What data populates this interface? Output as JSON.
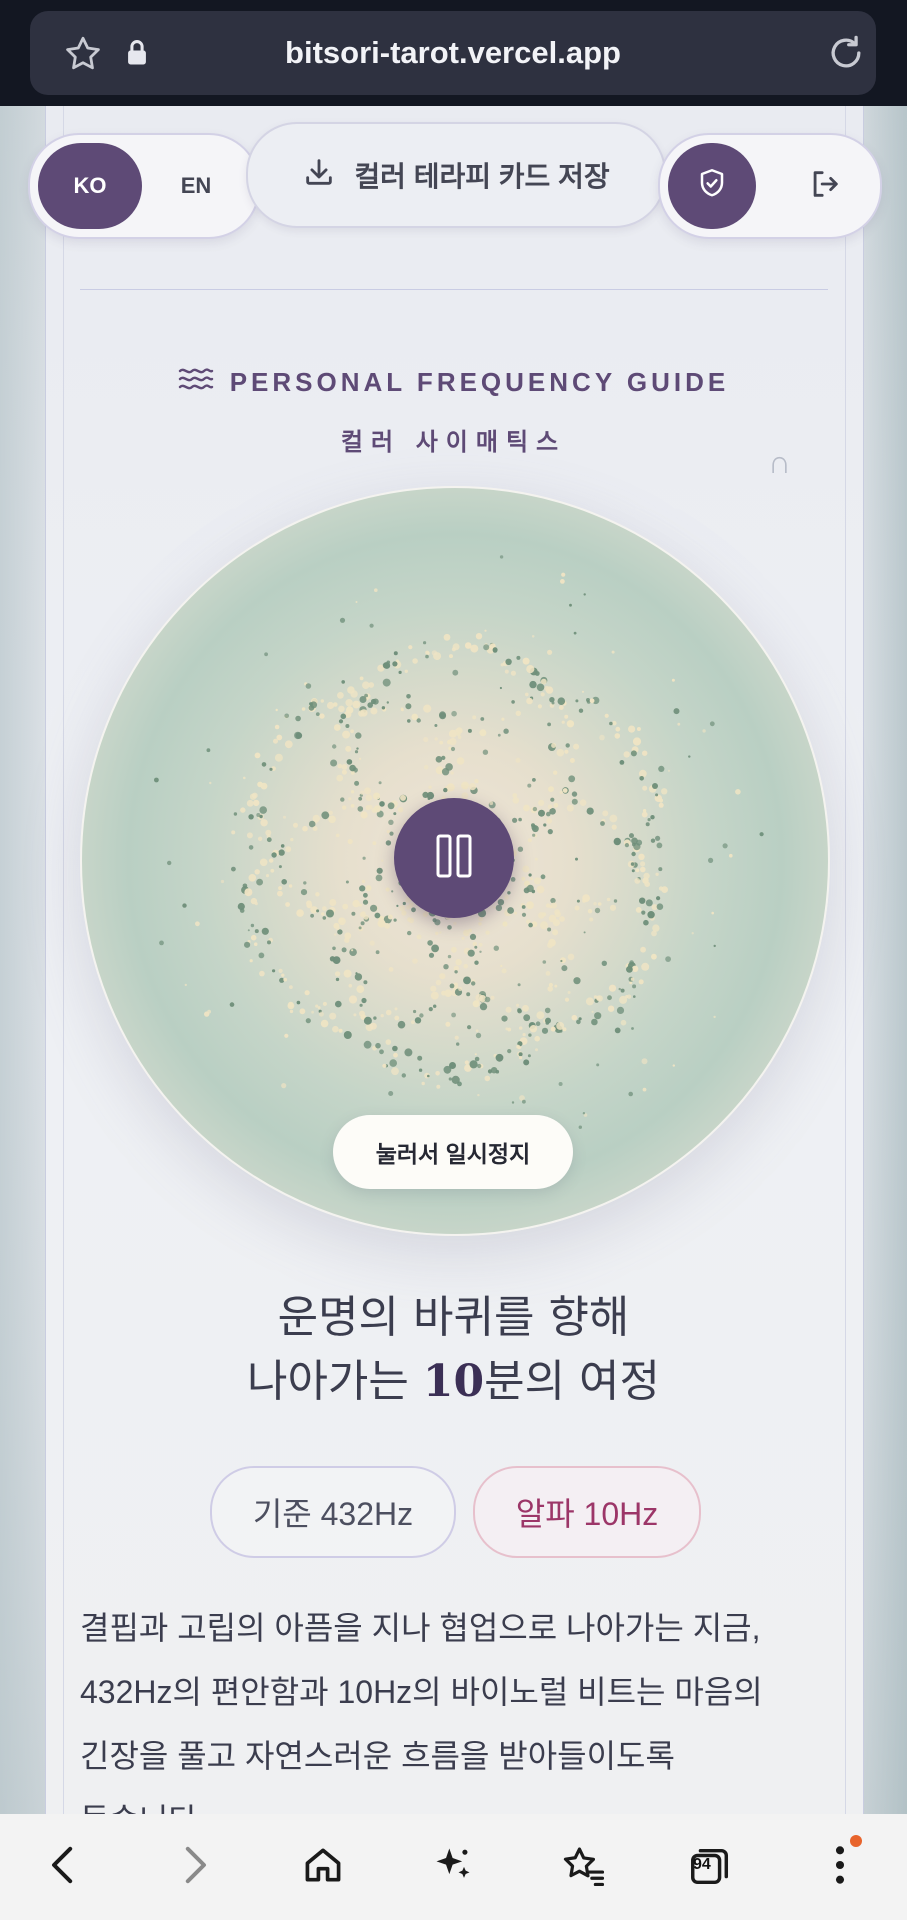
{
  "browser": {
    "url": "bitsori-tarot.vercel.app",
    "icons": [
      "star-outline-icon",
      "lock-icon",
      "reload-icon"
    ]
  },
  "header": {
    "lang_ko": "KO",
    "lang_en": "EN",
    "save_label": "컬러 테라피 카드 저장",
    "icons": [
      "download-icon",
      "shield-check-icon",
      "logout-icon"
    ]
  },
  "guide": {
    "title": "PERSONAL FREQUENCY GUIDE",
    "subtitle": "컬러 사이매틱스",
    "icon": "waves-icon"
  },
  "player": {
    "state": "playing",
    "pause_hint": "눌러서 일시정지",
    "icon": "pause-icon"
  },
  "headline": {
    "line1": "운명의 바퀴를 향해",
    "line2_pre": "나아가는 ",
    "line2_num": "10",
    "line2_post": "분의 여정"
  },
  "chips": {
    "base": "기준 432Hz",
    "alpha": "알파 10Hz"
  },
  "description": {
    "line1": "결핍과 고립의 아픔을 지나 협업으로 나아가는 지금,",
    "line2": "432Hz의 편안함과 10Hz의 바이노럴 비트는 마음의",
    "line3": "긴장을 풀고 자연스러운 흐름을 받아들이도록",
    "line4": "돕습니다."
  },
  "navbar": {
    "tab_count": "94",
    "icons": [
      "back-icon",
      "forward-icon",
      "home-icon",
      "sparkle-icon",
      "bookmarks-icon",
      "tabs-icon",
      "more-icon"
    ]
  },
  "colors": {
    "accent": "#5e4a76",
    "alpha_chip": "#9c3668",
    "gold_particle": "#efe4c4",
    "green_particle": "#6f8f7a"
  }
}
